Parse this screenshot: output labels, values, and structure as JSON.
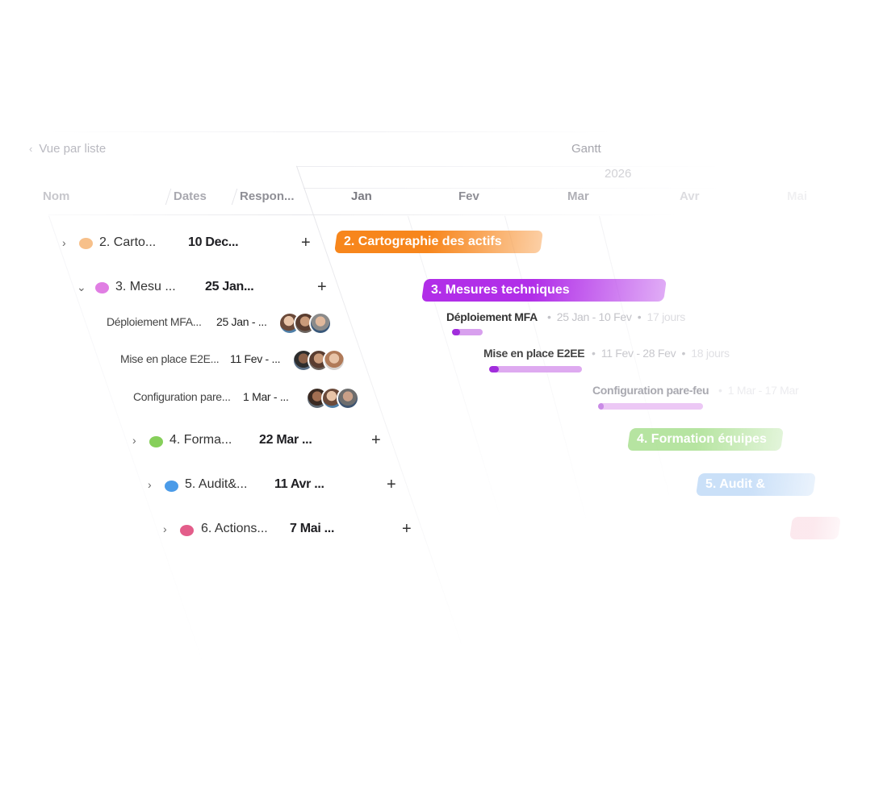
{
  "nav": {
    "back_label": "Vue par liste",
    "view_title": "Gantt"
  },
  "timeline": {
    "year": "2026",
    "months": [
      "Jan",
      "Fev",
      "Mar",
      "Avr",
      "Mai"
    ]
  },
  "columns": {
    "name": "Nom",
    "dates": "Dates",
    "responsible": "Respon..."
  },
  "groups": [
    {
      "label": "2. Carto...",
      "date": "10 Dec...",
      "color": "#f7c08a",
      "bar_label": "2. Cartographie des actifs",
      "bar_color": "#f7861c"
    },
    {
      "label": "3. Mesu ...",
      "date": "25 Jan...",
      "color": "#e07ee3",
      "bar_label": "3. Mesures techniques",
      "bar_color": "#b12ee8"
    },
    {
      "label": "4. Forma...",
      "date": "22 Mar ...",
      "color": "#86cf5a",
      "bar_label": "4. Formation équipes",
      "bar_color": "#7ccf55"
    },
    {
      "label": "5. Audit&...",
      "date": "11 Avr ...",
      "color": "#4b9be8",
      "bar_label": "5. Audit &",
      "bar_color": "#6aa7ec"
    },
    {
      "label": "6. Actions...",
      "date": "7 Mai ...",
      "color": "#e35d8a",
      "bar_label": "",
      "bar_color": "#e86a8a"
    }
  ],
  "subtasks": [
    {
      "name": "Déploiement MFA...",
      "date": "25 Jan - ...",
      "gantt_name": "Déploiement MFA",
      "gantt_dates": "25 Jan - 10 Fev",
      "gantt_duration": "17 jours",
      "progress": 0.25
    },
    {
      "name": "Mise en place E2E...",
      "date": "11 Fev - ...",
      "gantt_name": "Mise en place E2EE",
      "gantt_dates": "11 Fev - 28 Fev",
      "gantt_duration": "18 jours",
      "progress": 0.1
    },
    {
      "name": "Configuration pare...",
      "date": "1 Mar - ...",
      "gantt_name": "Configuration pare-feu",
      "gantt_dates": "1 Mar - 17 Mar",
      "gantt_duration": "",
      "progress": 0.05
    }
  ],
  "icons": {
    "back": "chevron-left-icon",
    "expand": "chevron-right-icon",
    "collapse": "chevron-down-icon",
    "add": "plus-icon"
  },
  "colors": {
    "accent_purple": "#b12ee8",
    "accent_orange": "#f7861c",
    "bar_purple_light": "#e3b3f4"
  }
}
